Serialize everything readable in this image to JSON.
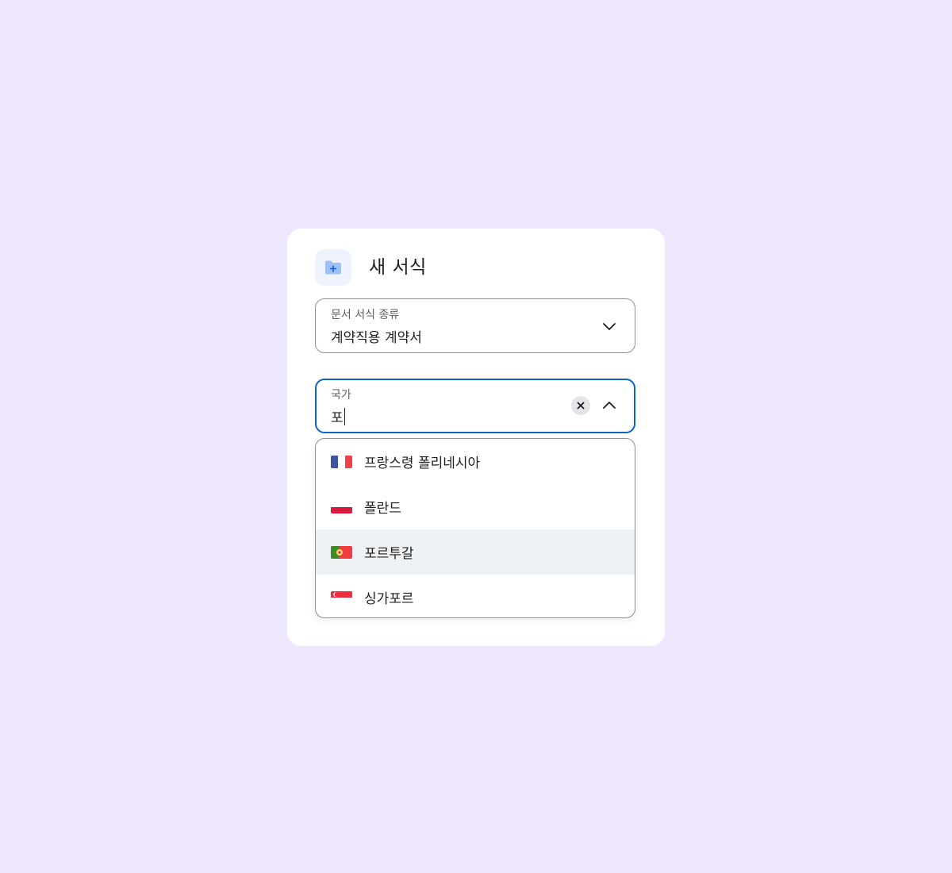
{
  "dialog": {
    "title": "새 서식",
    "icon": "folder-add-icon"
  },
  "document_type_field": {
    "label": "문서 서식 종류",
    "value": "계약직용 계약서",
    "icon": "chevron-down-icon"
  },
  "country_field": {
    "label": "국가",
    "value": "포",
    "clear_icon": "close-icon",
    "toggle_icon": "chevron-up-icon",
    "focus_color": "#0b64c8"
  },
  "country_options": [
    {
      "label": "프랑스령 폴리네시아",
      "flag": "flag-france-icon",
      "highlighted": false
    },
    {
      "label": "폴란드",
      "flag": "flag-poland-icon",
      "highlighted": false
    },
    {
      "label": "포르투갈",
      "flag": "flag-portugal-icon",
      "highlighted": true
    },
    {
      "label": "싱가포르",
      "flag": "flag-singapore-icon",
      "highlighted": false
    }
  ],
  "colors": {
    "background": "#ede6fd",
    "card": "#ffffff",
    "highlight": "#eff2f5",
    "accent": "#0b64c8"
  }
}
